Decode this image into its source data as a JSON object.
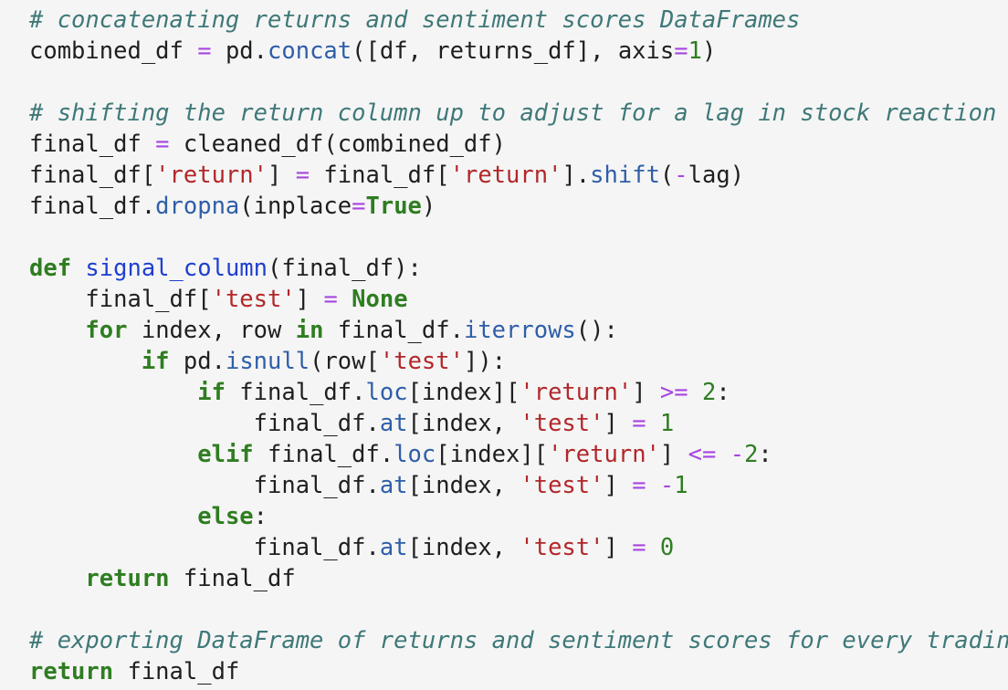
{
  "colors": {
    "background": "#f5f5f5",
    "plain": "#1f1f1f",
    "comment": "#3f7878",
    "keyword": "#2f7d21",
    "operator": "#a845e0",
    "string": "#b2272a",
    "number": "#2f7d21",
    "method": "#2f5ea8",
    "function_name": "#1f3fd0"
  },
  "code_lines": [
    [
      [
        "comment",
        "# concatenating returns and sentiment scores DataFrames"
      ]
    ],
    [
      [
        "plain",
        "combined_df "
      ],
      [
        "operator",
        "="
      ],
      [
        "plain",
        " pd."
      ],
      [
        "method",
        "concat"
      ],
      [
        "plain",
        "([df, returns_df], axis"
      ],
      [
        "operator",
        "="
      ],
      [
        "number",
        "1"
      ],
      [
        "plain",
        ")"
      ]
    ],
    [],
    [
      [
        "comment",
        "# shifting the return column up to adjust for a lag in stock reaction"
      ]
    ],
    [
      [
        "plain",
        "final_df "
      ],
      [
        "operator",
        "="
      ],
      [
        "plain",
        " cleaned_df(combined_df)"
      ]
    ],
    [
      [
        "plain",
        "final_df["
      ],
      [
        "string",
        "'return'"
      ],
      [
        "plain",
        "] "
      ],
      [
        "operator",
        "="
      ],
      [
        "plain",
        " final_df["
      ],
      [
        "string",
        "'return'"
      ],
      [
        "plain",
        "]."
      ],
      [
        "method",
        "shift"
      ],
      [
        "plain",
        "("
      ],
      [
        "operator",
        "-"
      ],
      [
        "plain",
        "lag)"
      ]
    ],
    [
      [
        "plain",
        "final_df."
      ],
      [
        "method",
        "dropna"
      ],
      [
        "plain",
        "(inplace"
      ],
      [
        "operator",
        "="
      ],
      [
        "constant",
        "True"
      ],
      [
        "plain",
        ")"
      ]
    ],
    [],
    [
      [
        "keyword",
        "def"
      ],
      [
        "plain",
        " "
      ],
      [
        "defname",
        "signal_column"
      ],
      [
        "plain",
        "(final_df):"
      ]
    ],
    [
      [
        "plain",
        "    final_df["
      ],
      [
        "string",
        "'test'"
      ],
      [
        "plain",
        "] "
      ],
      [
        "operator",
        "="
      ],
      [
        "plain",
        " "
      ],
      [
        "constant",
        "None"
      ]
    ],
    [
      [
        "plain",
        "    "
      ],
      [
        "keyword",
        "for"
      ],
      [
        "plain",
        " index, row "
      ],
      [
        "keyword",
        "in"
      ],
      [
        "plain",
        " final_df."
      ],
      [
        "method",
        "iterrows"
      ],
      [
        "plain",
        "():"
      ]
    ],
    [
      [
        "plain",
        "        "
      ],
      [
        "keyword",
        "if"
      ],
      [
        "plain",
        " pd."
      ],
      [
        "method",
        "isnull"
      ],
      [
        "plain",
        "(row["
      ],
      [
        "string",
        "'test'"
      ],
      [
        "plain",
        "]):"
      ]
    ],
    [
      [
        "plain",
        "            "
      ],
      [
        "keyword",
        "if"
      ],
      [
        "plain",
        " final_df."
      ],
      [
        "method",
        "loc"
      ],
      [
        "plain",
        "[index]["
      ],
      [
        "string",
        "'return'"
      ],
      [
        "plain",
        "] "
      ],
      [
        "operator",
        ">="
      ],
      [
        "plain",
        " "
      ],
      [
        "number",
        "2"
      ],
      [
        "plain",
        ":"
      ]
    ],
    [
      [
        "plain",
        "                final_df."
      ],
      [
        "method",
        "at"
      ],
      [
        "plain",
        "[index, "
      ],
      [
        "string",
        "'test'"
      ],
      [
        "plain",
        "] "
      ],
      [
        "operator",
        "="
      ],
      [
        "plain",
        " "
      ],
      [
        "number",
        "1"
      ]
    ],
    [
      [
        "plain",
        "            "
      ],
      [
        "keyword",
        "elif"
      ],
      [
        "plain",
        " final_df."
      ],
      [
        "method",
        "loc"
      ],
      [
        "plain",
        "[index]["
      ],
      [
        "string",
        "'return'"
      ],
      [
        "plain",
        "] "
      ],
      [
        "operator",
        "<="
      ],
      [
        "plain",
        " "
      ],
      [
        "operator",
        "-"
      ],
      [
        "number",
        "2"
      ],
      [
        "plain",
        ":"
      ]
    ],
    [
      [
        "plain",
        "                final_df."
      ],
      [
        "method",
        "at"
      ],
      [
        "plain",
        "[index, "
      ],
      [
        "string",
        "'test'"
      ],
      [
        "plain",
        "] "
      ],
      [
        "operator",
        "="
      ],
      [
        "plain",
        " "
      ],
      [
        "operator",
        "-"
      ],
      [
        "number",
        "1"
      ]
    ],
    [
      [
        "plain",
        "            "
      ],
      [
        "keyword",
        "else"
      ],
      [
        "plain",
        ":"
      ]
    ],
    [
      [
        "plain",
        "                final_df."
      ],
      [
        "method",
        "at"
      ],
      [
        "plain",
        "[index, "
      ],
      [
        "string",
        "'test'"
      ],
      [
        "plain",
        "] "
      ],
      [
        "operator",
        "="
      ],
      [
        "plain",
        " "
      ],
      [
        "number",
        "0"
      ]
    ],
    [
      [
        "plain",
        "    "
      ],
      [
        "keyword",
        "return"
      ],
      [
        "plain",
        " final_df"
      ]
    ],
    [],
    [
      [
        "comment",
        "# exporting DataFrame of returns and sentiment scores for every trading day"
      ]
    ],
    [
      [
        "keyword",
        "return"
      ],
      [
        "plain",
        " final_df"
      ]
    ]
  ]
}
